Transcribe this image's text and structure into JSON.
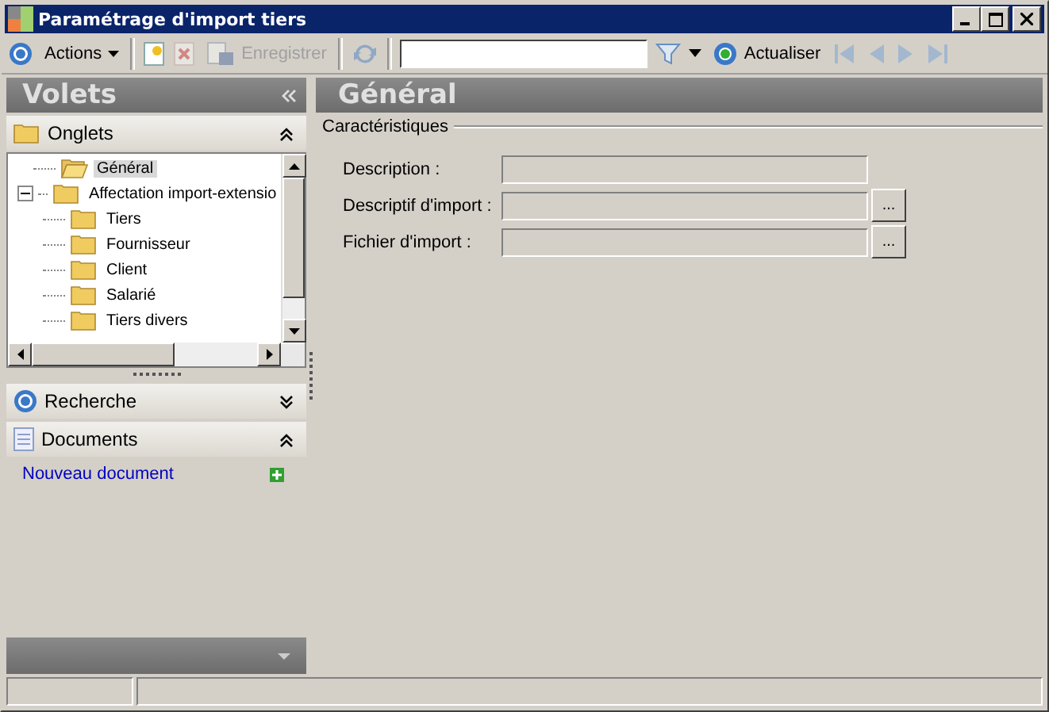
{
  "window": {
    "title": "Paramétrage d'import tiers"
  },
  "toolbar": {
    "items": [
      {
        "kind": "icon",
        "disabled": false
      },
      {
        "kind": "menu",
        "label": "Actions",
        "disabled": false
      },
      {
        "kind": "sep"
      },
      {
        "kind": "icon",
        "disabled": false
      },
      {
        "kind": "icon",
        "disabled": true
      },
      {
        "kind": "button",
        "label": "Enregistrer",
        "disabled": true
      },
      {
        "kind": "sep"
      },
      {
        "kind": "icon",
        "disabled": true
      },
      {
        "kind": "sep"
      },
      {
        "kind": "search"
      },
      {
        "kind": "icon",
        "disabled": false
      },
      {
        "kind": "caret"
      },
      {
        "kind": "button",
        "label": "Actualiser",
        "disabled": false
      },
      {
        "kind": "icon",
        "disabled": true
      },
      {
        "kind": "icon",
        "disabled": true
      },
      {
        "kind": "icon",
        "disabled": true
      },
      {
        "kind": "icon",
        "disabled": true
      }
    ]
  },
  "sidebar": {
    "title": "Volets",
    "panels": [
      {
        "kind": "tree",
        "label": "Onglets",
        "expanded": true,
        "items": [
          {
            "label": "Général",
            "selected": true
          },
          {
            "label": "Affectation import-extensio",
            "selected": false,
            "expanded": true,
            "children": [
              {
                "label": "Tiers",
                "selected": false
              },
              {
                "label": "Fournisseur",
                "selected": false
              },
              {
                "label": "Client",
                "selected": false
              },
              {
                "label": "Salarié",
                "selected": false
              },
              {
                "label": "Tiers divers",
                "selected": false
              }
            ]
          }
        ]
      },
      {
        "kind": "search",
        "label": "Recherche",
        "expanded": false
      },
      {
        "kind": "docs",
        "label": "Documents",
        "expanded": true,
        "links": [
          "Nouveau document"
        ]
      }
    ]
  },
  "content": {
    "title": "Général",
    "group": "Caractéristiques",
    "fields": [
      {
        "label": "Description :"
      },
      {
        "label": "Descriptif d'import :",
        "button": "..."
      },
      {
        "label": "Fichier d'import :",
        "button": "..."
      }
    ]
  }
}
